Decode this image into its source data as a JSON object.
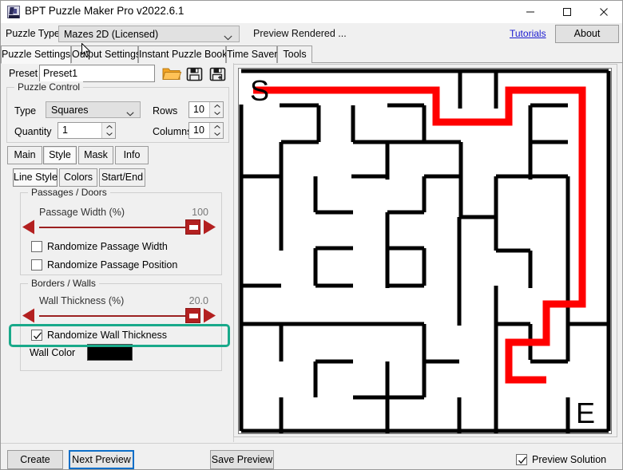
{
  "window": {
    "title": "BPT Puzzle Maker Pro v2022.6.1",
    "app_icon": "bpt-app-icon",
    "minimize": "minimize-icon",
    "maximize": "maximize-icon",
    "close": "close-icon"
  },
  "puzzle_type_row": {
    "label": "Puzzle Type",
    "selected": "Mazes 2D (Licensed)",
    "status": "Preview Rendered ...",
    "tutorials_link": "Tutorials",
    "about_button": "About"
  },
  "main_tabs": [
    {
      "label": "Puzzle Settings",
      "active": true
    },
    {
      "label": "Output Settings",
      "active": false
    },
    {
      "label": "Instant Puzzle Books",
      "active": false
    },
    {
      "label": "Time Saver",
      "active": false
    },
    {
      "label": "Tools",
      "active": false
    }
  ],
  "preset": {
    "label": "Preset",
    "value": "Preset1",
    "placeholder": "",
    "open_icon": "open-folder-icon",
    "save_icon": "save-disk-icon",
    "save_as_icon": "save-as-disk-icon"
  },
  "puzzle_control": {
    "group_label": "Puzzle Control",
    "type_label": "Type",
    "type_value": "Squares",
    "rows_label": "Rows",
    "rows_value": "10",
    "quantity_label": "Quantity",
    "quantity_value": "1",
    "columns_label": "Columns",
    "columns_value": "10"
  },
  "inner_tabs_row1": [
    {
      "label": "Main",
      "active": false
    },
    {
      "label": "Style",
      "active": true
    },
    {
      "label": "Mask",
      "active": false
    },
    {
      "label": "Info",
      "active": false
    }
  ],
  "inner_tabs_row2": [
    {
      "label": "Line Style",
      "active": true
    },
    {
      "label": "Colors",
      "active": false
    },
    {
      "label": "Start/End",
      "active": false
    }
  ],
  "passages_group": {
    "group_label": "Passages / Doors",
    "slider_label": "Passage Width (%)",
    "slider_value": "100",
    "checkbox_width": {
      "label": "Randomize Passage Width",
      "checked": false
    },
    "checkbox_position": {
      "label": "Randomize Passage Position",
      "checked": false
    }
  },
  "borders_group": {
    "group_label": "Borders / Walls",
    "slider_label": "Wall Thickness (%)",
    "slider_value": "20.0",
    "checkbox_thickness": {
      "label": "Randomize Wall Thickness",
      "checked": true,
      "highlighted": true
    },
    "wall_color_label": "Wall Color",
    "wall_color_value": "#000000"
  },
  "preview": {
    "start_label": "S",
    "end_label": "E",
    "solution_color": "#ff0000",
    "wall_color": "#000000"
  },
  "bottom_bar": {
    "create_button": "Create",
    "next_preview_button": "Next Preview",
    "save_preview_button": "Save Preview",
    "preview_solution": {
      "label": "Preview Solution",
      "checked": true
    }
  },
  "colors": {
    "highlight": "#19a98a",
    "slider_red": "#b32020",
    "link_blue": "#1a1ad0",
    "focus_blue": "#0d6ec8"
  }
}
